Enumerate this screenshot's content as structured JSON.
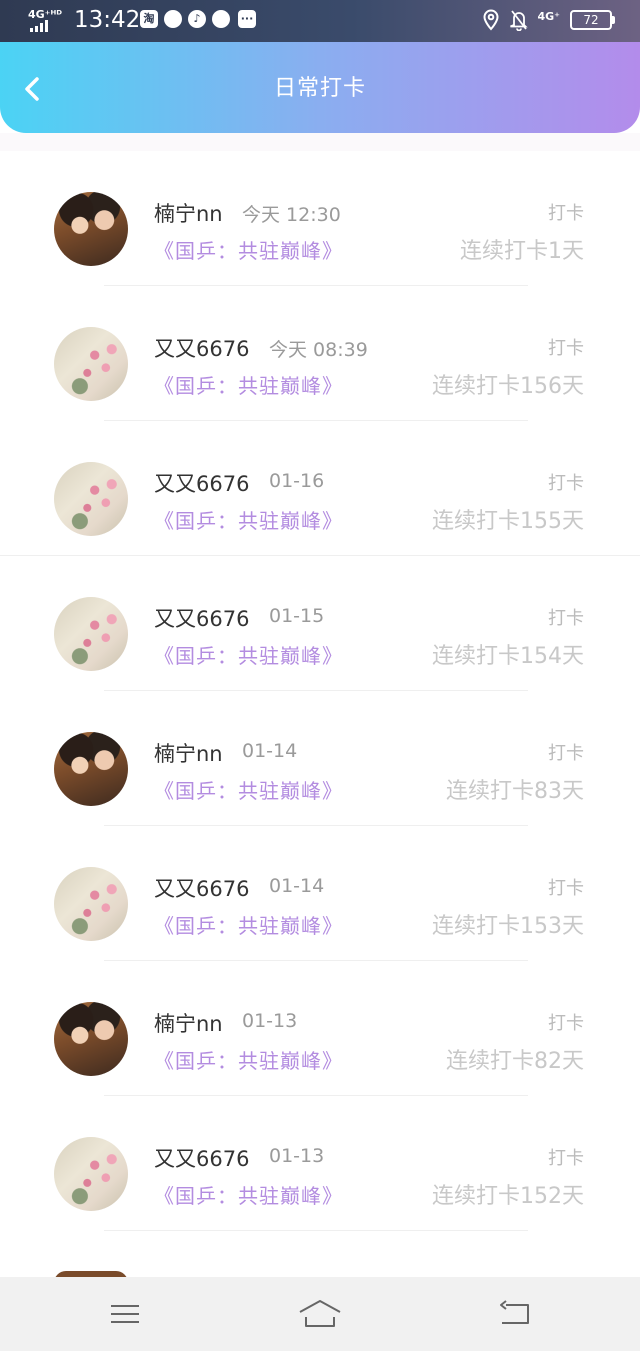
{
  "status_bar": {
    "network_left": "4G⁺ᴴᴰ",
    "time": "13:42",
    "app_icons": [
      "淘",
      "",
      "♪",
      ""
    ],
    "more": "···",
    "network_right": "4G⁺",
    "battery": "72",
    "icons": [
      "location-icon",
      "bell-off-icon"
    ]
  },
  "header": {
    "title": "日常打卡"
  },
  "records": [
    {
      "name": "楠宁nn",
      "time": "今天 12:30",
      "book": "《国乒：共驻巅峰》",
      "tag": "打卡",
      "streak": "连续打卡1天",
      "avatar": "kids"
    },
    {
      "name": "又又6676",
      "time": "今天 08:39",
      "book": "《国乒：共驻巅峰》",
      "tag": "打卡",
      "streak": "连续打卡156天",
      "avatar": "flower"
    },
    {
      "name": "又又6676",
      "time": "01-16",
      "book": "《国乒：共驻巅峰》",
      "tag": "打卡",
      "streak": "连续打卡155天",
      "avatar": "flower"
    },
    {
      "name": "又又6676",
      "time": "01-15",
      "book": "《国乒：共驻巅峰》",
      "tag": "打卡",
      "streak": "连续打卡154天",
      "avatar": "flower"
    },
    {
      "name": "楠宁nn",
      "time": "01-14",
      "book": "《国乒：共驻巅峰》",
      "tag": "打卡",
      "streak": "连续打卡83天",
      "avatar": "kids"
    },
    {
      "name": "又又6676",
      "time": "01-14",
      "book": "《国乒：共驻巅峰》",
      "tag": "打卡",
      "streak": "连续打卡153天",
      "avatar": "flower"
    },
    {
      "name": "楠宁nn",
      "time": "01-13",
      "book": "《国乒：共驻巅峰》",
      "tag": "打卡",
      "streak": "连续打卡82天",
      "avatar": "kids"
    },
    {
      "name": "又又6676",
      "time": "01-13",
      "book": "《国乒：共驻巅峰》",
      "tag": "打卡",
      "streak": "连续打卡152天",
      "avatar": "flower"
    }
  ],
  "nav_bar": {
    "buttons": [
      "menu-icon",
      "home-icon",
      "back-icon"
    ]
  },
  "colors": {
    "header_start": "#4bd3f4",
    "header_end": "#b38ceb",
    "book_title": "#b38ce0",
    "streak_text": "#c8c8c8"
  }
}
